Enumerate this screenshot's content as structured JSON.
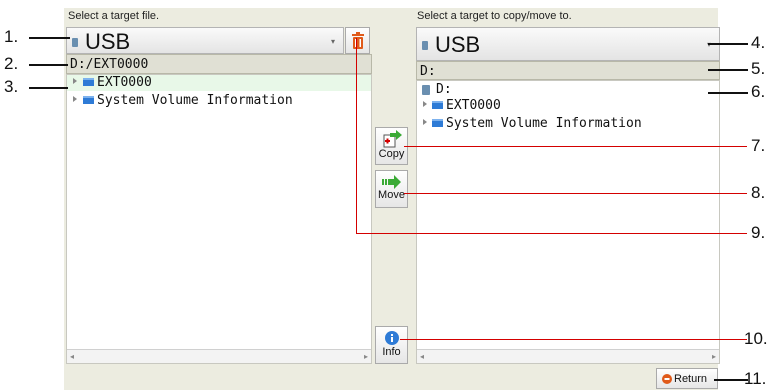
{
  "left": {
    "header": "Select a target file.",
    "device": "USB",
    "path": "D:/EXT0000",
    "tree": [
      "EXT0000",
      "System Volume Information"
    ]
  },
  "right": {
    "header": "Select a target to copy/move to.",
    "device": "USB",
    "path": "D:",
    "tree": [
      "D:",
      "EXT0000",
      "System Volume Information"
    ]
  },
  "buttons": {
    "copy": "Copy",
    "move": "Move",
    "info": "Info",
    "return": "Return"
  },
  "callouts": [
    "1.",
    "2.",
    "3.",
    "4.",
    "5.",
    "6.",
    "7.",
    "8.",
    "9.",
    "10.",
    "11."
  ],
  "colors": {
    "panel": "#ecece0",
    "folder": "#2e7bd6",
    "callout_line": "#d40000",
    "delete_icon": "#e05a1a",
    "arrow_green": "#3aaa35"
  },
  "icons": {
    "device": "usb-icon",
    "delete": "trash-icon",
    "copy": "copy-icon",
    "move": "move-arrow-icon",
    "info": "info-icon",
    "return": "return-icon"
  }
}
